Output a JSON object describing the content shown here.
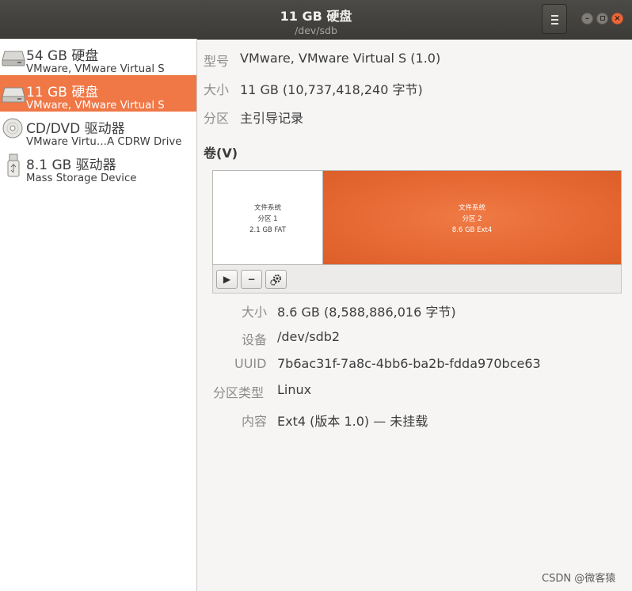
{
  "window": {
    "title": "11 GB 硬盘",
    "subtitle": "/dev/sdb",
    "menu_icon": "hamburger-menu-icon",
    "controls": [
      "minimize",
      "maximize",
      "close"
    ]
  },
  "drives": [
    {
      "name": "54 GB 硬盘",
      "description": "VMware, VMware Virtual S",
      "icon": "hard-disk-icon",
      "selected": false
    },
    {
      "name": "11 GB 硬盘",
      "description": "VMware, VMware Virtual S",
      "icon": "hard-disk-icon",
      "selected": true
    },
    {
      "name": "CD/DVD 驱动器",
      "description": "VMware Virtu…A CDRW Drive",
      "icon": "optical-disc-icon",
      "selected": false
    },
    {
      "name": "8.1 GB 驱动器",
      "description": "Mass Storage Device",
      "icon": "usb-drive-icon",
      "selected": false
    }
  ],
  "disk_info": {
    "model_label": "型号",
    "model_value": "VMware, VMware Virtual S (1.0)",
    "size_label": "大小",
    "size_value": "11 GB (10,737,418,240 字节)",
    "partition_label": "分区",
    "partition_value": "主引导记录"
  },
  "volumes": {
    "heading": "卷(V)",
    "partitions": [
      {
        "line1": "文件系统",
        "line2": "分区 1",
        "line3": "2.1 GB FAT",
        "selected": false
      },
      {
        "line1": "文件系统",
        "line2": "分区 2",
        "line3": "8.6 GB Ext4",
        "selected": true
      }
    ],
    "toolbar_icons": [
      "play-icon",
      "minus-icon",
      "gears-icon"
    ]
  },
  "volume_details": {
    "size_label": "大小",
    "size_value": "8.6 GB (8,588,886,016 字节)",
    "device_label": "设备",
    "device_value": "/dev/sdb2",
    "uuid_label": "UUID",
    "uuid_value": "7b6ac31f-7a8c-4bb6-ba2b-fdda970bce63",
    "type_label": "分区类型",
    "type_value": "Linux",
    "contents_label": "内容",
    "contents_value": "Ext4 (版本 1.0) — 未挂载"
  },
  "watermark": "CSDN @微客猿",
  "colors": {
    "accent": "#f07746",
    "titlebar": "#3c3b37",
    "close_button": "#e9683a"
  }
}
